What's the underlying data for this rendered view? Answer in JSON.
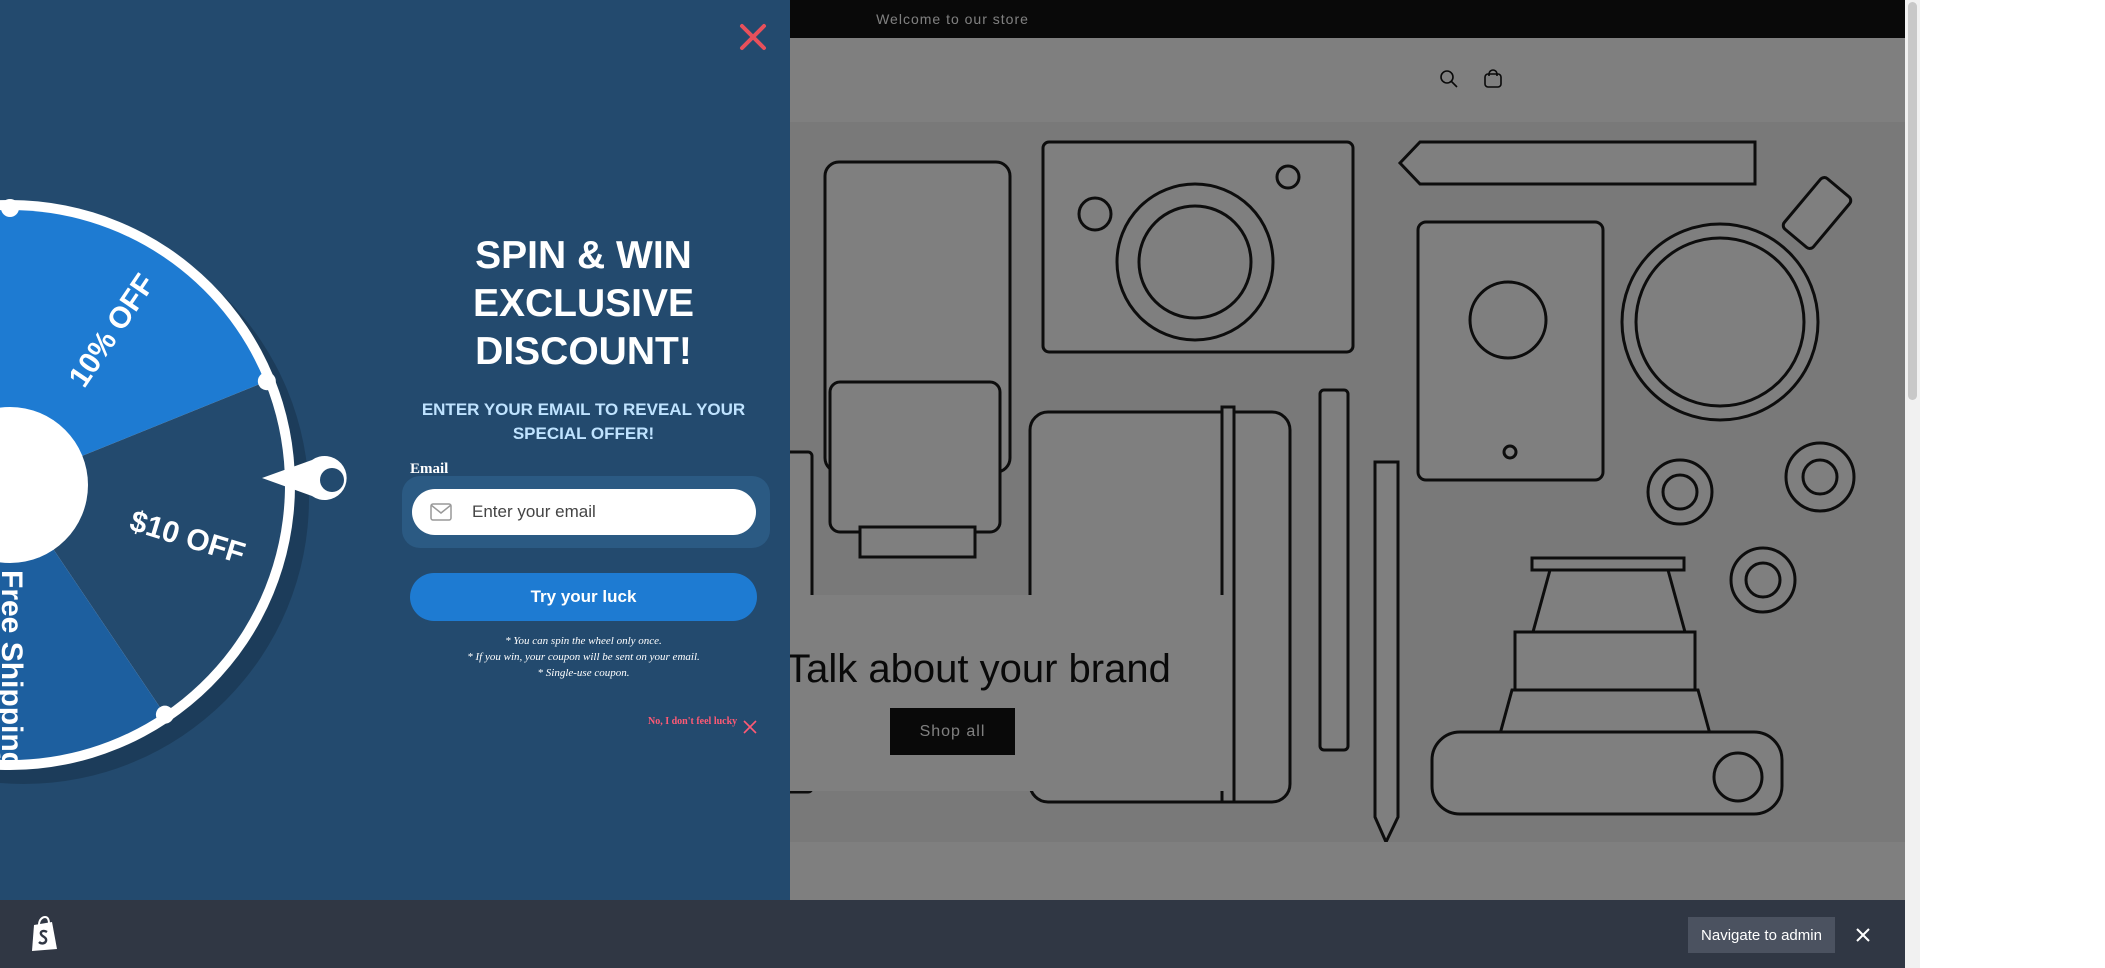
{
  "store": {
    "announcement": "Welcome to our store",
    "header_icons": [
      "search-icon",
      "cart-icon"
    ],
    "banner": {
      "heading": "Talk about your brand",
      "button": "Shop all"
    }
  },
  "popup": {
    "title": "SPIN & WIN EXCLUSIVE DISCOUNT!",
    "subtitle": "ENTER YOUR EMAIL TO REVEAL YOUR SPECIAL OFFER!",
    "email_label": "Email",
    "email_placeholder": "Enter your email",
    "button": "Try your luck",
    "notes": [
      "* You can spin the wheel only once.",
      "* If you win, your coupon will be sent on your email.",
      "* Single-use coupon."
    ],
    "decline": "No, I don't feel lucky",
    "wheel_segments": [
      {
        "label": "10% OFF",
        "color": "#1e7bd2"
      },
      {
        "label": "$10 OFF",
        "color": "#234a6e"
      },
      {
        "label": "Free Shipping",
        "color": "#1d5f9f"
      }
    ],
    "colors": {
      "background": "#234a6e",
      "accent": "#1e7bd2",
      "close": "#e8505b",
      "decline": "#ff5a75"
    }
  },
  "admin_bar": {
    "navigate_button": "Navigate to admin"
  }
}
